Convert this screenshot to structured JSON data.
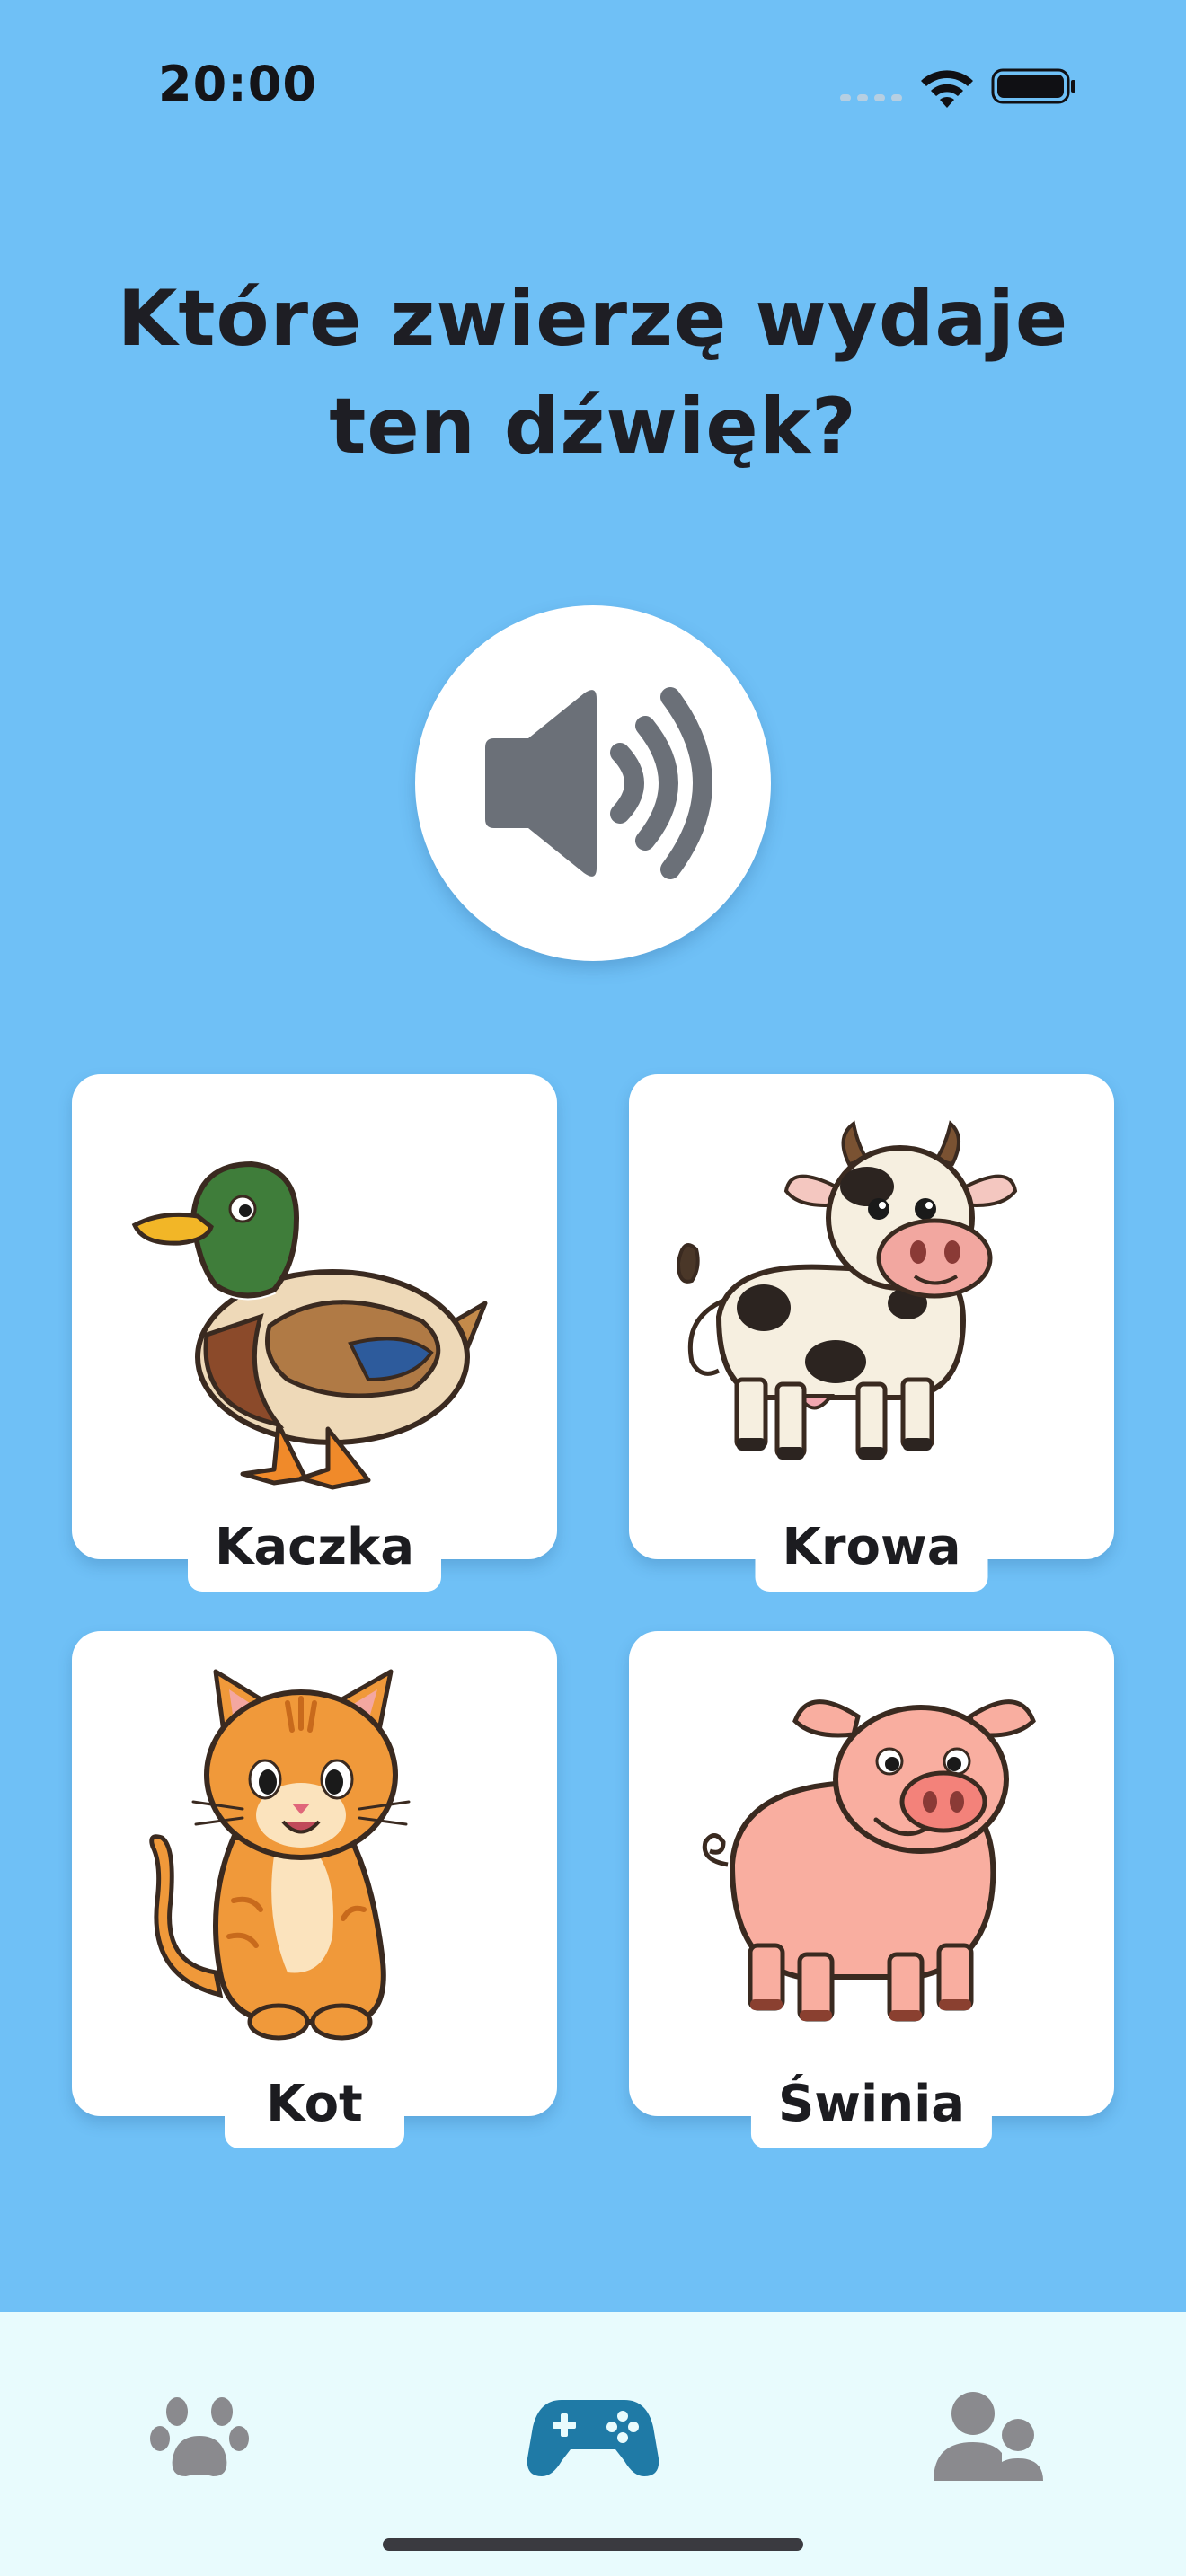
{
  "status_bar": {
    "time": "20:00",
    "icons": [
      "cellular-signal-icon",
      "wifi-icon",
      "battery-icon"
    ]
  },
  "question": {
    "line1": "Które zwierzę wydaje",
    "line2": "ten dźwięk?"
  },
  "sound_button": {
    "icon": "speaker-volume-icon"
  },
  "answers": [
    {
      "label": "Kaczka",
      "icon": "duck-illustration"
    },
    {
      "label": "Krowa",
      "icon": "cow-illustration"
    },
    {
      "label": "Kot",
      "icon": "cat-illustration"
    },
    {
      "label": "Świnia",
      "icon": "pig-illustration"
    }
  ],
  "tab_bar": {
    "tabs": [
      {
        "icon": "paw-icon",
        "active": false
      },
      {
        "icon": "gamepad-icon",
        "active": true
      },
      {
        "icon": "users-icon",
        "active": false
      }
    ]
  },
  "colors": {
    "background": "#6fc0f6",
    "tab_bar_background": "#e8fbfd",
    "active_tab": "#1f7aa6",
    "inactive_tab": "#8a8a8e",
    "speaker": "#6b7078"
  }
}
